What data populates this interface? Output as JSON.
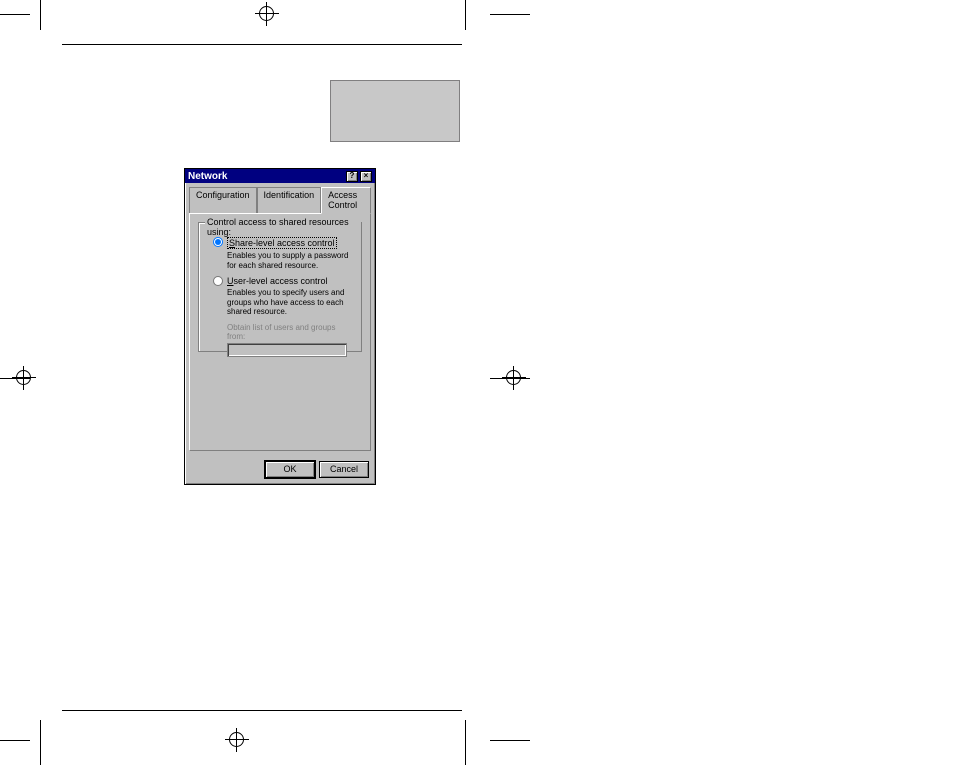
{
  "dialog": {
    "title": "Network",
    "help_btn": "?",
    "close_btn": "×",
    "tabs": {
      "configuration": "Configuration",
      "identification": "Identification",
      "access_control": "Access Control"
    },
    "groupbox_legend": "Control access to shared resources using:",
    "share_level": {
      "label_prefix": "S",
      "label_rest": "hare-level access control",
      "desc": "Enables you to supply a password for each shared resource."
    },
    "user_level": {
      "label_prefix": "U",
      "label_rest": "ser-level access control",
      "desc": "Enables you to specify users and groups who have access to each shared resource.",
      "obtain_label": "Obtain list of users and groups from:"
    },
    "buttons": {
      "ok": "OK",
      "cancel": "Cancel"
    }
  }
}
